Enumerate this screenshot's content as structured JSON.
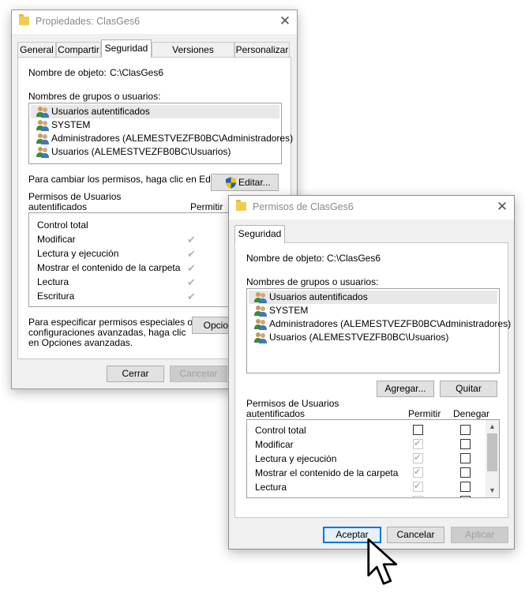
{
  "back": {
    "title": "Propiedades: ClasGes6",
    "tabs": [
      "General",
      "Compartir",
      "Seguridad",
      "Versiones anteriores",
      "Personalizar"
    ],
    "object_label": "Nombre de objeto:",
    "object_value": "C:\\ClasGes6",
    "groups_label": "Nombres de grupos o usuarios:",
    "groups": [
      "Usuarios autentificados",
      "SYSTEM",
      "Administradores (ALEMESTVEZFB0BC\\Administradores)",
      "Usuarios (ALEMESTVEZFB0BC\\Usuarios)"
    ],
    "change_text": "Para cambiar los permisos, haga clic en Editar.",
    "edit_button": "Editar...",
    "perm_label_1": "Permisos de Usuarios",
    "perm_label_2": "autentificados",
    "allow_header": "Permitir",
    "perms": [
      "Control total",
      "Modificar",
      "Lectura y ejecución",
      "Mostrar el contenido de la carpeta",
      "Lectura",
      "Escritura"
    ],
    "special_1": "Para especificar permisos especiales o",
    "special_2": "configuraciones avanzadas, haga clic",
    "special_3": "en Opciones avanzadas.",
    "options_button": "Opciones",
    "close_button": "Cerrar",
    "cancel_button": "Cancelar"
  },
  "front": {
    "title": "Permisos de ClasGes6",
    "tab": "Seguridad",
    "object_label": "Nombre de objeto:",
    "object_value": "C:\\ClasGes6",
    "groups_label": "Nombres de grupos o usuarios:",
    "groups": [
      "Usuarios autentificados",
      "SYSTEM",
      "Administradores (ALEMESTVEZFB0BC\\Administradores)",
      "Usuarios (ALEMESTVEZFB0BC\\Usuarios)"
    ],
    "add_button": "Agregar...",
    "remove_button": "Quitar",
    "perm_label_1": "Permisos de Usuarios",
    "perm_label_2": "autentificados",
    "allow_header": "Permitir",
    "deny_header": "Denegar",
    "perms": [
      "Control total",
      "Modificar",
      "Lectura y ejecución",
      "Mostrar el contenido de la carpeta",
      "Lectura"
    ],
    "accept_button": "Aceptar",
    "cancel_button": "Cancelar",
    "apply_button": "Aplicar"
  },
  "icons": {
    "folder": "folder-icon",
    "close": "close-icon",
    "users": "users-icon",
    "shield": "uac-shield-icon",
    "cursor": "mouse-cursor-icon"
  },
  "colors": {
    "accent": "#0078d7",
    "folder": "#f2cc50"
  }
}
